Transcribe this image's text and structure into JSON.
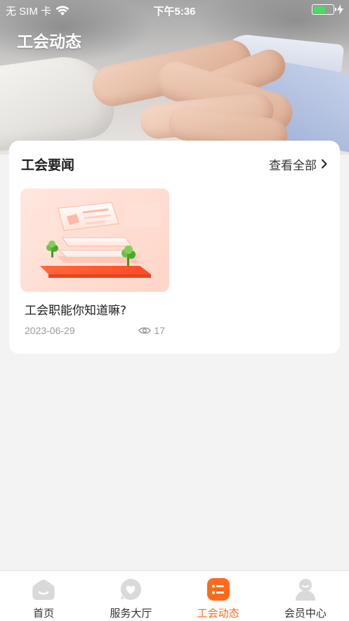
{
  "status_bar": {
    "carrier": "无 SIM 卡",
    "time": "下午5:36",
    "battery_level": 0.6
  },
  "header": {
    "title": "工会动态"
  },
  "news_section": {
    "title": "工会要闻",
    "view_all_label": "查看全部",
    "items": [
      {
        "title": "工会职能你知道嘛?",
        "date": "2023-06-29",
        "views": "17",
        "thumbnail_icon": "news-illustration"
      }
    ]
  },
  "tabbar": {
    "items": [
      {
        "label": "首页",
        "icon": "home-icon",
        "active": false
      },
      {
        "label": "服务大厅",
        "icon": "service-icon",
        "active": false
      },
      {
        "label": "工会动态",
        "icon": "news-list-icon",
        "active": true
      },
      {
        "label": "会员中心",
        "icon": "member-icon",
        "active": false
      }
    ]
  },
  "colors": {
    "accent": "#ff6a1a",
    "inactive_icon": "#d9d9d9",
    "background": "#f3f3f3",
    "battery": "#4cd964"
  }
}
